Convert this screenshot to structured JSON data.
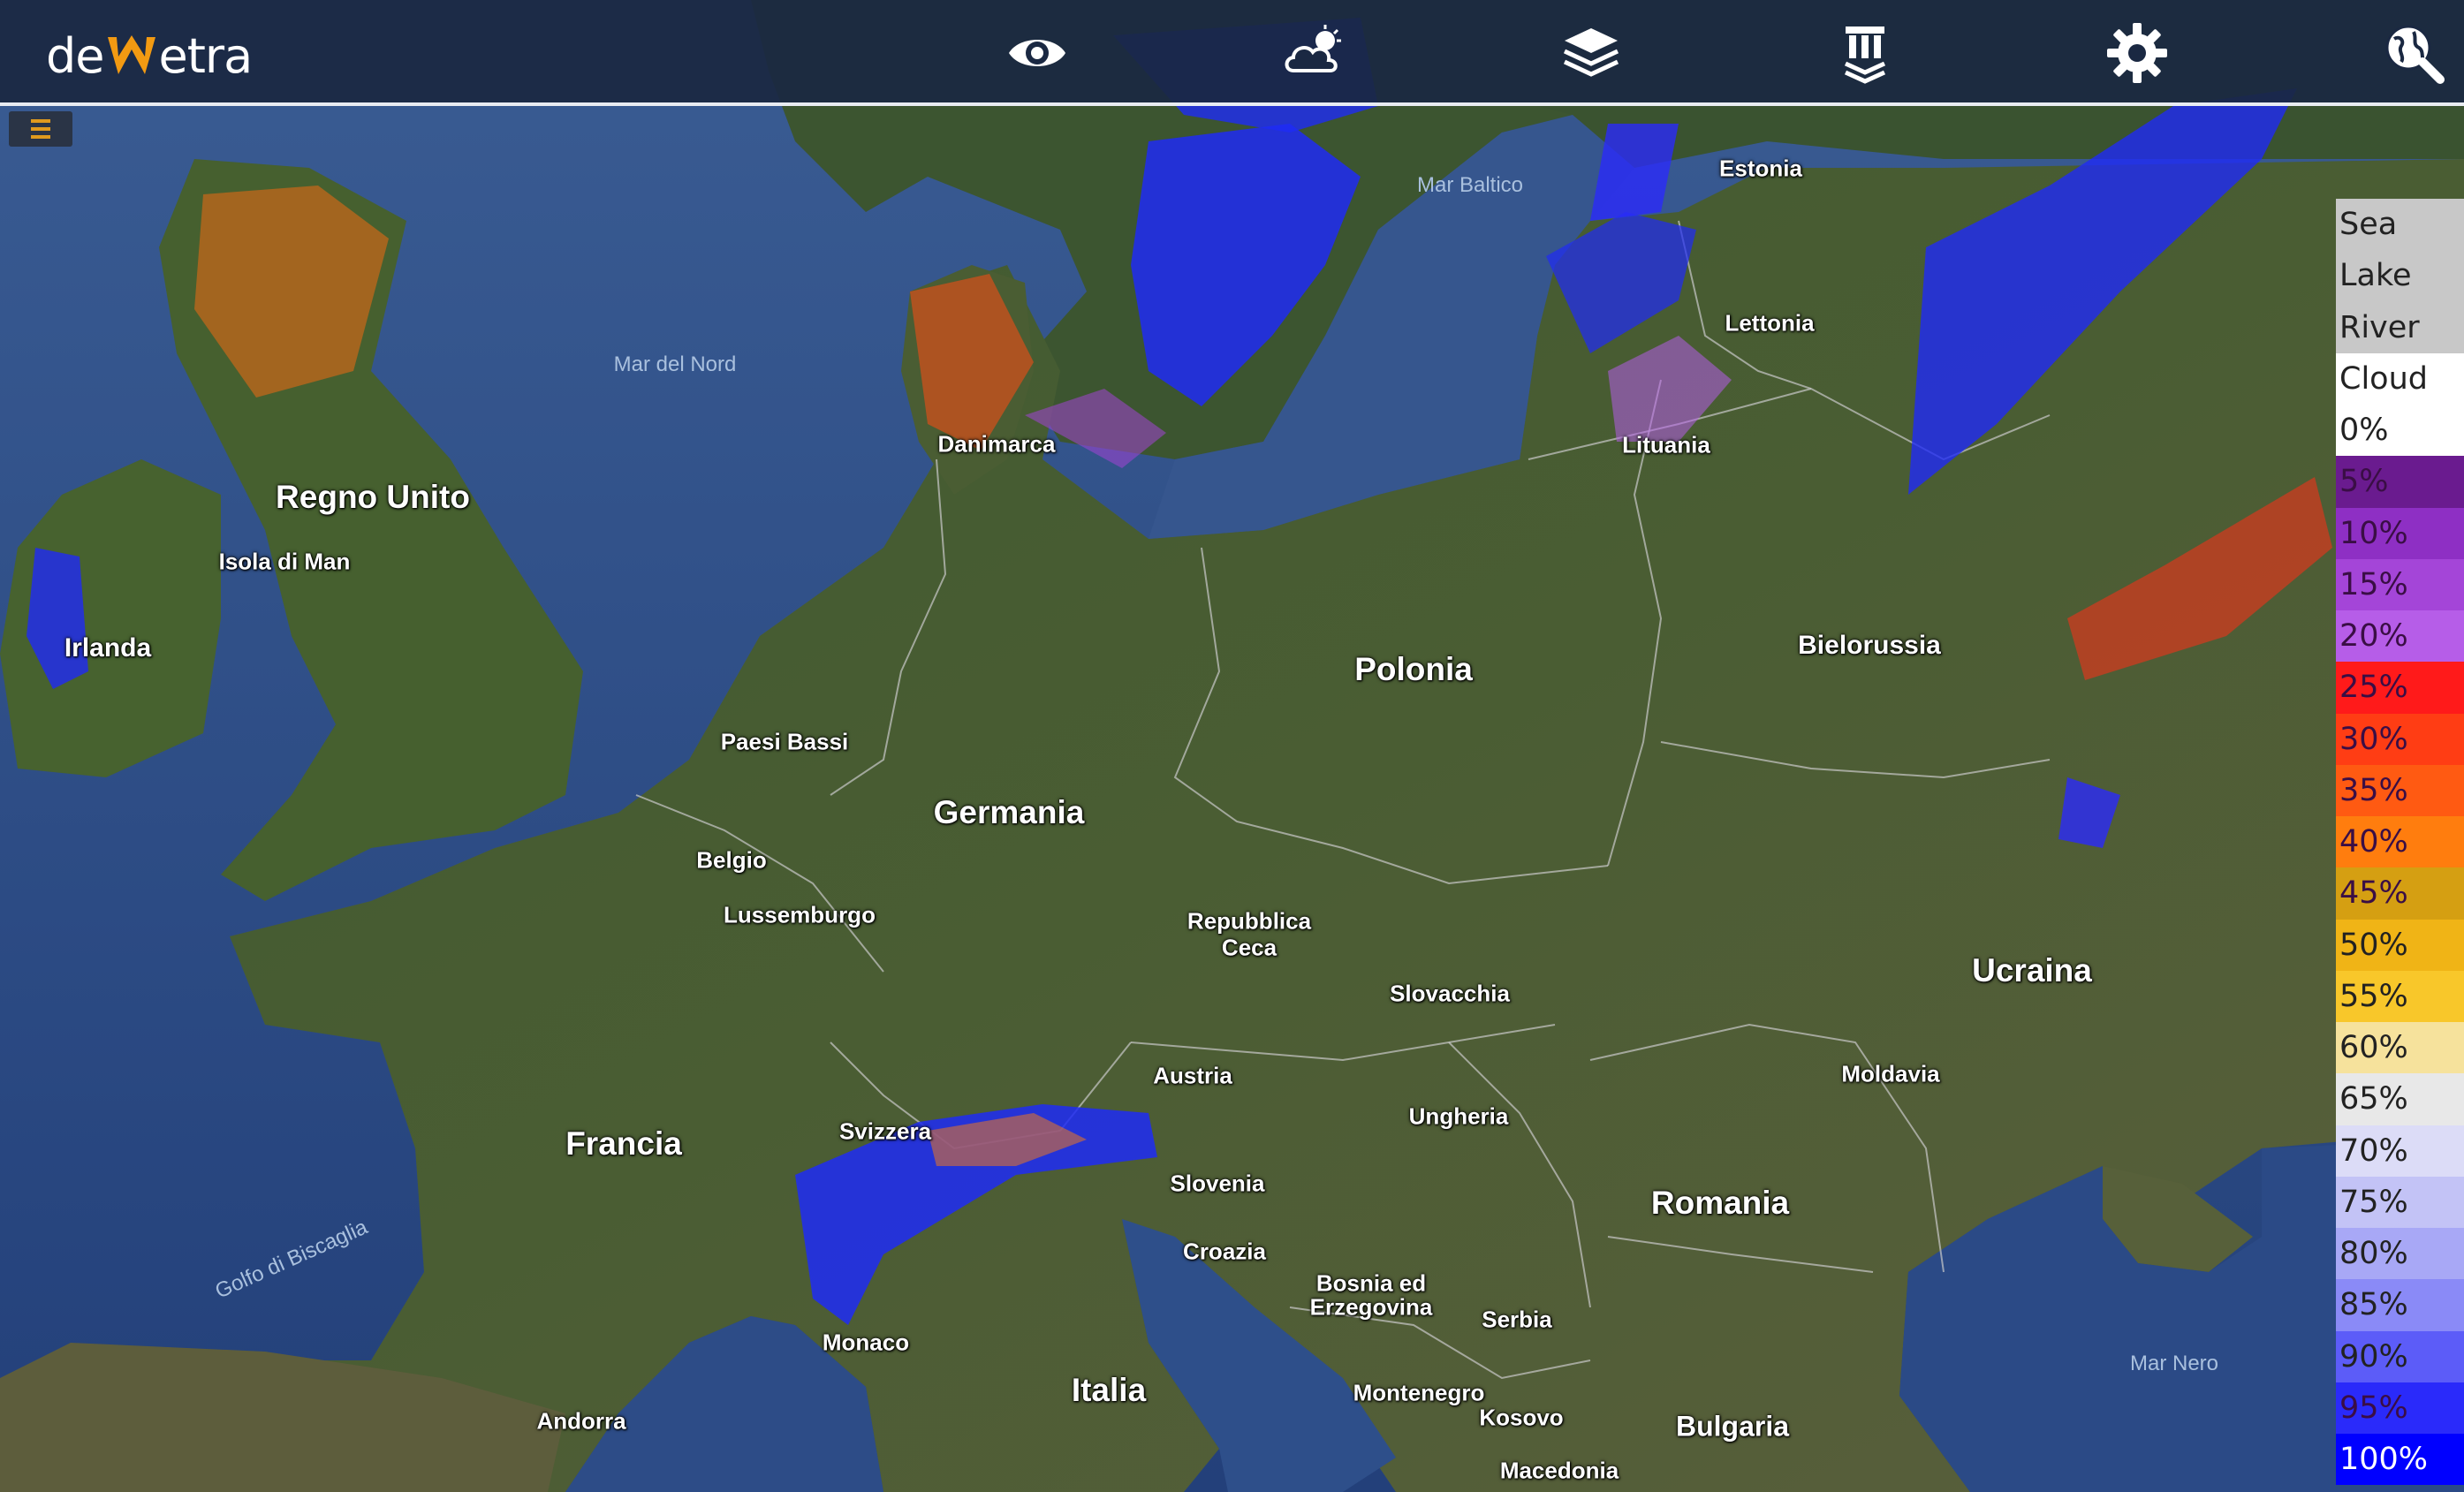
{
  "app": {
    "logo_text_left": "de",
    "logo_text_right": "etra",
    "logo_letter": "W"
  },
  "toolbar": [
    {
      "name": "eye-icon-button",
      "icon": "eye-icon"
    },
    {
      "name": "weather-button",
      "icon": "cloud-sun-icon"
    },
    {
      "name": "layers-button",
      "icon": "layers-icon"
    },
    {
      "name": "institution-layers-button",
      "icon": "column-stack-icon"
    },
    {
      "name": "settings-button",
      "icon": "gear-icon"
    },
    {
      "name": "geo-search-button",
      "icon": "globe-search-icon"
    }
  ],
  "menu_icon": "hamburger-icon",
  "map": {
    "labels": {
      "estonia": "Estonia",
      "lettonia": "Lettonia",
      "lituania": "Lituania",
      "bielorussia": "Bielorussia",
      "polonia": "Polonia",
      "danimarca": "Danimarca",
      "regno_unito": "Regno Unito",
      "isola_di_man": "Isola di Man",
      "irlanda": "Irlanda",
      "paesi_bassi": "Paesi Bassi",
      "germania": "Germania",
      "belgio": "Belgio",
      "lussemburgo": "Lussemburgo",
      "repubblica": "Repubblica",
      "ceca": "Ceca",
      "slovacchia": "Slovacchia",
      "ucraina": "Ucraina",
      "austria": "Austria",
      "moldavia": "Moldavia",
      "ungheria": "Ungheria",
      "francia": "Francia",
      "svizzera": "Svizzera",
      "slovenia": "Slovenia",
      "romania": "Romania",
      "croazia": "Croazia",
      "bosnia": "Bosnia ed",
      "erzegovina": "Erzegovina",
      "serbia": "Serbia",
      "monaco": "Monaco",
      "italia": "Italia",
      "montenegro": "Montenegro",
      "kosovo": "Kosovo",
      "bulgaria": "Bulgaria",
      "andorra": "Andorra",
      "macedonia": "Macedonia",
      "mar_baltico": "Mar Baltico",
      "mar_del_nord": "Mar del Nord",
      "golfo_di_biscaglia": "Golfo di Biscaglia",
      "mar_nero": "Mar Nero"
    }
  },
  "legend": [
    {
      "label": "Sea",
      "color": "#c8c8c8"
    },
    {
      "label": "Lake",
      "color": "#c8c8c8"
    },
    {
      "label": "River",
      "color": "#c8c8c8"
    },
    {
      "label": "Cloud",
      "color": "#ffffff"
    },
    {
      "label": "0%",
      "color": "#ffffff"
    },
    {
      "label": "5%",
      "color": "#6a1b8f"
    },
    {
      "label": "10%",
      "color": "#8e2fc4"
    },
    {
      "label": "15%",
      "color": "#a445d8"
    },
    {
      "label": "20%",
      "color": "#b65de8"
    },
    {
      "label": "25%",
      "color": "#ff1a1a"
    },
    {
      "label": "30%",
      "color": "#ff3d14"
    },
    {
      "label": "35%",
      "color": "#ff5a12"
    },
    {
      "label": "40%",
      "color": "#ff7d0e"
    },
    {
      "label": "45%",
      "color": "#d59f12"
    },
    {
      "label": "50%",
      "color": "#f0b416"
    },
    {
      "label": "55%",
      "color": "#f8c72a"
    },
    {
      "label": "60%",
      "color": "#f6e29c"
    },
    {
      "label": "65%",
      "color": "#e8e8e8"
    },
    {
      "label": "70%",
      "color": "#dcdcf7"
    },
    {
      "label": "75%",
      "color": "#c3c3f6"
    },
    {
      "label": "80%",
      "color": "#a8a8f6"
    },
    {
      "label": "85%",
      "color": "#8a8af7"
    },
    {
      "label": "90%",
      "color": "#5c5cf8"
    },
    {
      "label": "95%",
      "color": "#2a2afa"
    },
    {
      "label": "100%",
      "color": "#0000ff"
    }
  ]
}
